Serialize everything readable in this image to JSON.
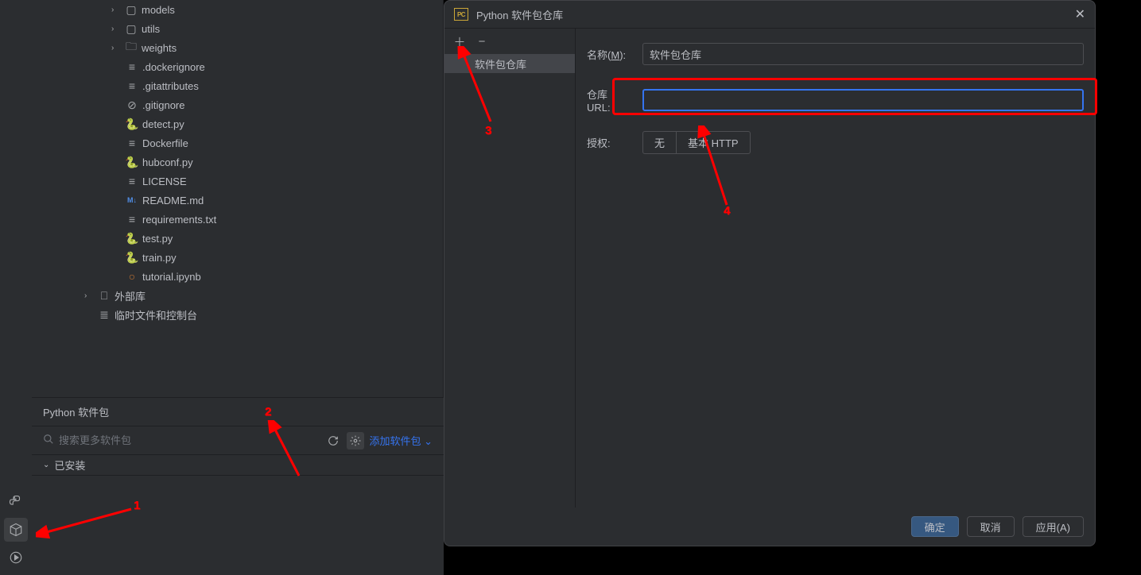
{
  "tree": {
    "models": "models",
    "utils": "utils",
    "weights": "weights",
    "dockerignore": ".dockerignore",
    "gitattributes": ".gitattributes",
    "gitignore": ".gitignore",
    "detect_py": "detect.py",
    "dockerfile": "Dockerfile",
    "hubconf_py": "hubconf.py",
    "license": "LICENSE",
    "readme": "README.md",
    "requirements": "requirements.txt",
    "test_py": "test.py",
    "train_py": "train.py",
    "tutorial": "tutorial.ipynb",
    "external_libs": "外部库",
    "scratches": "临时文件和控制台"
  },
  "panel": {
    "title": "Python 软件包",
    "search_placeholder": "搜索更多软件包",
    "add_packages": "添加软件包",
    "installed": "已安装"
  },
  "dialog": {
    "title": "Python 软件包仓库",
    "sidebar_item": "软件包仓库",
    "name_label": "名称(",
    "name_mnemonic": "M",
    "name_label_end": "):",
    "name_value": "软件包仓库",
    "url_label": "仓库 URL:",
    "url_value": "",
    "auth_label": "授权:",
    "auth_none": "无",
    "auth_http": "基本 HTTP",
    "ok": "确定",
    "cancel": "取消",
    "apply": "应用(A)"
  },
  "annotations": {
    "n1": "1",
    "n2": "2",
    "n3": "3",
    "n4": "4"
  }
}
